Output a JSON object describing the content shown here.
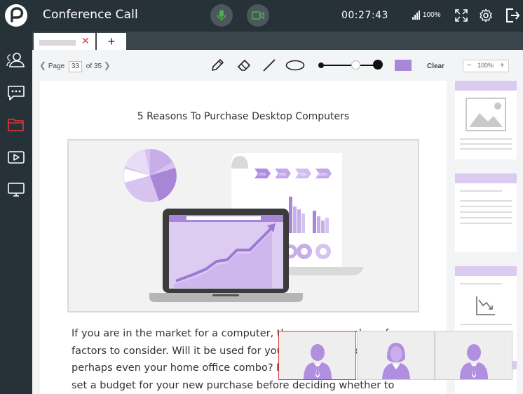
{
  "app": {
    "title": "Conference Call",
    "timer": "00:27:43",
    "battery": "100%",
    "accent_color": "#4caf50",
    "highlight_color": "#e53935"
  },
  "header_icons": [
    "microphone-icon",
    "video-camera-icon",
    "signal-icon",
    "fullscreen-icon",
    "gear-icon",
    "exit-icon"
  ],
  "sidebar": {
    "items": [
      {
        "name": "participants",
        "icon": "users-icon"
      },
      {
        "name": "chat",
        "icon": "chat-bubble-icon"
      },
      {
        "name": "files",
        "icon": "folder-icon",
        "active": true
      },
      {
        "name": "media",
        "icon": "play-icon"
      },
      {
        "name": "screen-share",
        "icon": "monitor-icon"
      }
    ]
  },
  "tabs": {
    "add_label": "+",
    "close_label": "✕"
  },
  "toolbar": {
    "page_label": "Page",
    "page_number": "33",
    "of_label": "of",
    "total_pages": "35",
    "clear_label": "Clear",
    "zoom_minus": "−",
    "zoom_value": "100%",
    "zoom_plus": "+",
    "pen_color": "#a987d9",
    "tools": [
      "pencil-icon",
      "eraser-icon",
      "line-icon",
      "ellipse-icon"
    ]
  },
  "document": {
    "title": "5 Reasons To Purchase Desktop Computers",
    "body": "If you are in the market for a computer, there are a number of factors to consider. Will it be used for your home, your office or perhaps even your home office combo? First off, you will need to set a budget for your new purchase before deciding whether to shop for notebook or desktop",
    "chart_labels": [
      "25%",
      "50%",
      "75%",
      "100%"
    ]
  },
  "video": {
    "participants": [
      {
        "name": "participant-1",
        "active": true
      },
      {
        "name": "participant-2",
        "active": false
      },
      {
        "name": "participant-3",
        "active": false
      }
    ]
  }
}
